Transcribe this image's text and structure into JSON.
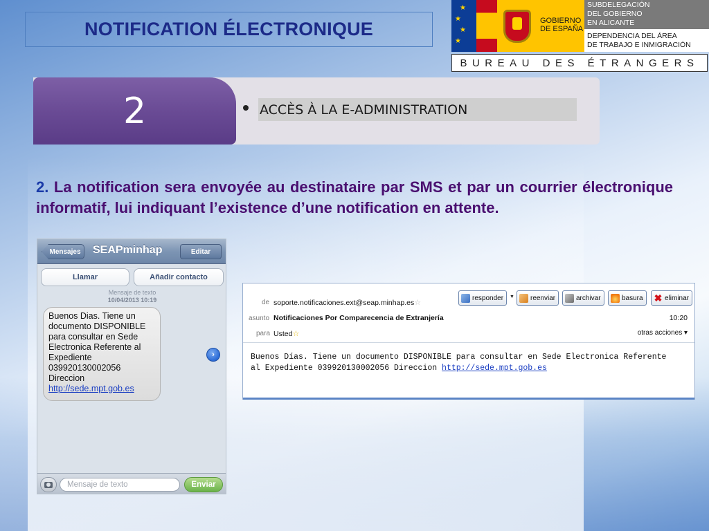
{
  "slide": {
    "title": "NOTIFICATION ÉLECTRONIQUE",
    "logo": {
      "gobierno_line1": "GOBIERNO",
      "gobierno_line2": "DE ESPAÑA",
      "subdeleg_line1": "SUBDELEGACIÓN",
      "subdeleg_line2": "DEL GOBIERNO",
      "subdeleg_line3": "EN ALICANTE",
      "dependencia_line1": "DEPENDENCIA DEL ÁREA",
      "dependencia_line2": "DE TRABAJO E INMIGRACIÓN"
    },
    "bureau": "BUREAU DES ÉTRANGERS",
    "step": {
      "number": "2",
      "label": "ACCÈS À LA E-ADMINISTRATION"
    },
    "paragraph": {
      "number": "2.",
      "text": " La notification sera envoyée au destinataire par SMS et par un courrier électronique informatif, lui indiquant l’existence d’une notification en attente."
    }
  },
  "sms": {
    "back_label": "Mensajes",
    "contact_title": "SEAPminhap",
    "edit_label": "Editar",
    "call_label": "Llamar",
    "add_contact_label": "Añadir contacto",
    "meta_label": "Mensaje de texto",
    "meta_date": "10/04/2013 10:19",
    "message_lines": [
      "Buenos Dias. Tiene un",
      "documento DISPONIBLE",
      "para consultar en Sede",
      "Electronica Referente al",
      "Expediente",
      "039920130002056",
      "Direccion"
    ],
    "message_link": "http://sede.mpt.gob.es",
    "compose_placeholder": "Mensaje de texto",
    "send_label": "Enviar"
  },
  "email": {
    "from_label": "de",
    "from_value": "soporte.notificaciones.ext@seap.minhap.es",
    "subject_label": "asunto",
    "subject_value": "Notificaciones Por Comparecencia de Extranjería",
    "to_label": "para",
    "to_value": "Usted",
    "time": "10:20",
    "more_actions": "otras acciones ▾",
    "buttons": {
      "reply": "responder",
      "forward": "reenviar",
      "archive": "archivar",
      "junk": "basura",
      "delete": "eliminar"
    },
    "body_line1": "Buenos Días. Tiene un documento DISPONIBLE para consultar en Sede Electronica Referente",
    "body_line2_prefix": "al Expediente 039920130002056 Direccion ",
    "body_link": "http://sede.mpt.gob.es"
  },
  "colors": {
    "title_text": "#1c2a88",
    "paragraph_text": "#4a0f70",
    "step_purple": "#6a4b95",
    "link": "#1a3ec2"
  }
}
